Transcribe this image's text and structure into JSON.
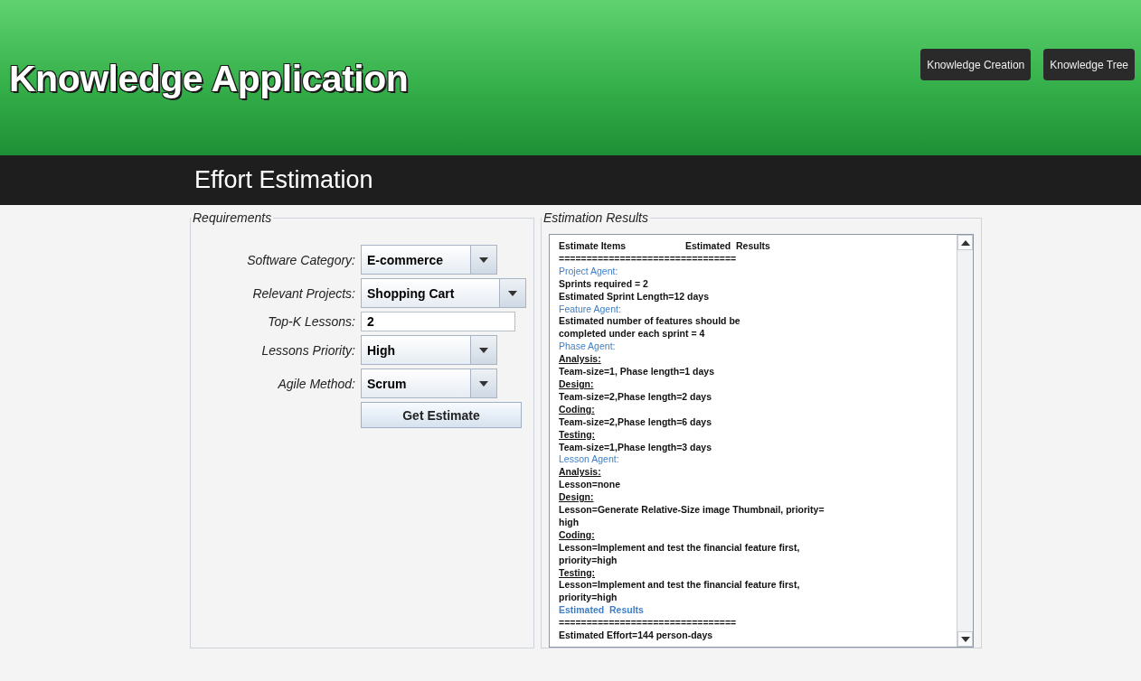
{
  "header": {
    "title": "Knowledge Application",
    "nav_buttons": [
      "Knowledge Creation",
      "Knowledge Tree"
    ]
  },
  "section_title": "Effort Estimation",
  "requirements": {
    "legend": "Requirements",
    "fields": [
      {
        "kind": "combo",
        "label": "Software Category:",
        "value": "E-commerce"
      },
      {
        "kind": "combo",
        "label": "Relevant Projects:",
        "value": "Shopping Cart"
      },
      {
        "kind": "text",
        "label": "Top-K Lessons:",
        "value": "2"
      },
      {
        "kind": "combo",
        "label": "Lessons Priority:",
        "value": "High"
      },
      {
        "kind": "combo",
        "label": "Agile Method:",
        "value": "Scrum"
      }
    ],
    "button": "Get Estimate"
  },
  "results": {
    "legend": "Estimation Results",
    "lines": [
      {
        "kind": "header",
        "text": "Estimate Items",
        "text_2": "Estimated  Results"
      },
      {
        "kind": "rule",
        "text": "================================"
      },
      {
        "kind": "agent",
        "text": "Project Agent:"
      },
      {
        "kind": "text",
        "text": "Sprints required = 2"
      },
      {
        "kind": "text",
        "text": "Estimated Sprint Length=12 days"
      },
      {
        "kind": "agent",
        "text": "Feature Agent:"
      },
      {
        "kind": "text",
        "text": "Estimated number of features should be"
      },
      {
        "kind": "text",
        "text": "completed under each sprint = 4"
      },
      {
        "kind": "agent",
        "text": "Phase Agent:"
      },
      {
        "kind": "heading",
        "text": "Analysis:"
      },
      {
        "kind": "text",
        "text": "Team-size=1, Phase length=1 days"
      },
      {
        "kind": "heading",
        "text": "Design:"
      },
      {
        "kind": "text",
        "text": "Team-size=2,Phase length=2 days"
      },
      {
        "kind": "heading",
        "text": "Coding:"
      },
      {
        "kind": "text",
        "text": "Team-size=2,Phase length=6 days"
      },
      {
        "kind": "heading",
        "text": "Testing:"
      },
      {
        "kind": "text",
        "text": "Team-size=1,Phase length=3 days"
      },
      {
        "kind": "agent",
        "text": "Lesson Agent:"
      },
      {
        "kind": "heading",
        "text": "Analysis:"
      },
      {
        "kind": "text",
        "text": "Lesson=none"
      },
      {
        "kind": "heading",
        "text": "Design:"
      },
      {
        "kind": "text",
        "text": "Lesson=Generate Relative-Size image Thumbnail, priority="
      },
      {
        "kind": "text",
        "text": "high"
      },
      {
        "kind": "heading",
        "text": "Coding:"
      },
      {
        "kind": "text",
        "text": "Lesson=Implement and test the financial feature first,"
      },
      {
        "kind": "text",
        "text": "priority=high"
      },
      {
        "kind": "heading",
        "text": "Testing:"
      },
      {
        "kind": "text",
        "text": "Lesson=Implement and test the financial feature first,"
      },
      {
        "kind": "text",
        "text": "priority=high"
      },
      {
        "kind": "summary",
        "text": "Estimated  Results"
      },
      {
        "kind": "rule",
        "text": "================================"
      },
      {
        "kind": "text",
        "text": "Estimated Effort=144 person-days"
      }
    ]
  }
}
